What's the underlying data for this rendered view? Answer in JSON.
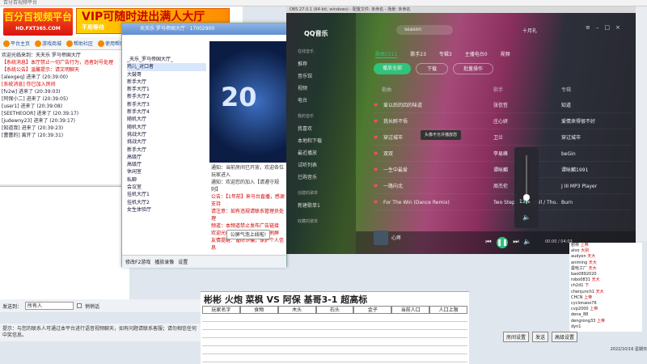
{
  "client": {
    "title": "百分百视频平台",
    "logo_main": "百分百视频平台",
    "logo_sub": "HD.FXT365.COM",
    "vip_text": "VIP可随时进出满人大厅",
    "vip_sub": "不用等待",
    "toolbar": [
      {
        "label": "平台主页"
      },
      {
        "label": "游戏商城"
      },
      {
        "label": "帮助社区"
      },
      {
        "label": "使用帮助"
      }
    ],
    "chatlog": [
      {
        "text": "欢迎光临来到：天天乐 罗马帝国大厅",
        "cls": "c1"
      },
      {
        "text": "【系统消息】本厅禁止一切广告行为，违者封号处理",
        "cls": "c2"
      },
      {
        "text": "【系统公告】温馨提示：请文明聊天",
        "cls": "c2"
      },
      {
        "text": "[alexgeq] 进来了 (20:39:00)",
        "cls": "c1"
      },
      {
        "text": "[系统消息] 你已加入房间",
        "cls": "c2"
      },
      {
        "text": "[fv2w] 进来了 (20:39:03)",
        "cls": "c1"
      },
      {
        "text": "[阿保小二] 进来了 (20:39:05)",
        "cls": "c1"
      },
      {
        "text": "[user1] 进来了 (20:39:08)",
        "cls": "c1"
      },
      {
        "text": "[SEETHEOOR] 进来了 (20:39:17)",
        "cls": "c1"
      },
      {
        "text": "[judewny23] 进来了 (20:39:17)",
        "cls": "c1"
      },
      {
        "text": "[知道我] 进来了 (20:39:23)",
        "cls": "c1"
      },
      {
        "text": "[蕾蕾的] 离开了 (20:39:31)",
        "cls": "c1"
      }
    ],
    "send_label": "发送到：",
    "send_target": "所有人",
    "private_label": "悄悄话",
    "tip_text": "提示：与您的联系人可通过本平台进行语音视频聊天，如有问题请联系客服；请勿相信任何中奖信息。"
  },
  "room": {
    "title": "天天乐 罗马帝国大厅",
    "id_label": "17002900",
    "tree": [
      {
        "label": "_天乐_罗马帝国大厅_",
        "hl": false
      },
      {
        "label": "  鸡儿_对口者",
        "hl": true
      },
      {
        "label": "  大鼓哥",
        "hl": false
      },
      {
        "label": "  新手大厅",
        "hl": false
      },
      {
        "label": "新手大厅1",
        "hl": false
      },
      {
        "label": "新手大厅2",
        "hl": false
      },
      {
        "label": "新手大厅3",
        "hl": false
      },
      {
        "label": "新手大厅4",
        "hl": false
      },
      {
        "label": "随机大厅",
        "hl": false
      },
      {
        "label": "随机大厅",
        "hl": false
      },
      {
        "label": "挑战大厅",
        "hl": false
      },
      {
        "label": "挑战大厅",
        "hl": false
      },
      {
        "label": "新手大厅",
        "hl": false
      },
      {
        "label": "高级厅",
        "hl": false
      },
      {
        "label": "高级厅",
        "hl": false
      },
      {
        "label": "休闲室",
        "hl": false
      },
      {
        "label": "私聊",
        "hl": false
      },
      {
        "label": "会议室",
        "hl": false
      },
      {
        "label": "挂机大厅1",
        "hl": false
      },
      {
        "label": "挂机大厅2",
        "hl": false
      },
      {
        "label": "女生体验厅",
        "hl": false
      }
    ],
    "video_text": "20",
    "announce": [
      {
        "text": "通知：当前房间已开放，欢迎各位玩家进入",
        "cls": ""
      },
      {
        "text": "通知：欢迎您的加入【请遵守规则】",
        "cls": ""
      },
      {
        "text": "公告：【1年前】来马台直播，感谢支持",
        "cls": "r"
      },
      {
        "text": "请注意：如有违规请联系管理员处理",
        "cls": "r"
      },
      {
        "text": "频道：本频道禁止发布广告链接",
        "cls": "r"
      },
      {
        "text": "欢迎光临：请文明聊天，勿刷屏",
        "cls": "r"
      },
      {
        "text": "友情提醒：谨防诈骗，保护个人信息",
        "cls": "r"
      }
    ],
    "bottom": [
      "修改F2游戏",
      "播放录像",
      "设置"
    ],
    "float_btn": "公屏气泡上线啦!"
  },
  "qq": {
    "title": "OBS 27.0.1 (64-bit, windows) - 配置文件: 未命名 - 场景: 未命名",
    "logo": "QQ音乐",
    "search": "season",
    "user": "十月礼",
    "side_head1": "在线音乐",
    "side_items1": [
      "推荐",
      "音乐馆",
      "视频",
      "电台"
    ],
    "side_head2": "我的音乐",
    "side_items2": [
      "我喜欢",
      "本地和下载",
      "最近播放",
      "试听列表",
      "已购音乐"
    ],
    "side_head3": "创建的歌单",
    "side_items3": [
      "新建歌单1"
    ],
    "side_head4": "收藏的歌单",
    "tabs": [
      "歌曲1511",
      "歌手23",
      "专辑3",
      "主播电台0",
      "视频"
    ],
    "play_all": "播放全部",
    "download": "下载",
    "batch": "批量操作",
    "col_song": "歌曲",
    "col_artist": "歌手",
    "col_album": "专辑",
    "songs": [
      {
        "title": "爱以后的四的味道",
        "artist": "张信哲",
        "album": "知道"
      },
      {
        "title": "我长醉不悟",
        "artist": "庄心妍",
        "album": "爱情来得很不好"
      },
      {
        "title": "穿过城市",
        "artist": "卫兰",
        "album": "穿过城市"
      },
      {
        "title": "双双",
        "artist": "李易峰",
        "album": "beGin"
      },
      {
        "title": "一生中最爱",
        "artist": "谭咏麟",
        "album": "谭咏麟1991"
      },
      {
        "title": "一路向北",
        "artist": "周杰伦",
        "album": "J III MP3 Player"
      },
      {
        "title": "For The Win (Dance Remix)",
        "artist": "Two Steps From Hell / Tho...",
        "album": "Burn"
      }
    ],
    "tooltip": "头像不允许播放您",
    "volume_label": "13%",
    "volume_level": 0.13,
    "now_playing": "心疼",
    "time": "00:00 / 04:03"
  },
  "sheet": {
    "title": "彬彬 火炮 菜枫 VS 阿保 基哥3-1 超高标",
    "headers": [
      "玩家名字",
      "食物",
      "木头",
      "石头",
      "金子",
      "当前人口",
      "人口上限"
    ]
  },
  "rbtns": [
    "房间设置",
    "发送",
    "高级设置"
  ],
  "users": [
    {
      "name": "剧林",
      "badge": "上帝"
    },
    {
      "name": "alvo",
      "badge": "大别"
    },
    {
      "name": "audyen",
      "badge": "天大"
    },
    {
      "name": "animing",
      "badge": "天大"
    },
    {
      "name": "曼哈工厂",
      "badge": "天大"
    },
    {
      "name": "bao0892020",
      "badge": ""
    },
    {
      "name": "robo0831",
      "badge": "天大"
    },
    {
      "name": "ch2d1",
      "badge": "下"
    },
    {
      "name": "chenjunch1",
      "badge": "天大"
    },
    {
      "name": "CHCN",
      "badge": "上帝"
    },
    {
      "name": "cyclonaoo76",
      "badge": ""
    },
    {
      "name": "cvp2000",
      "badge": "上帝"
    },
    {
      "name": "dena_88",
      "badge": ""
    },
    {
      "name": "dengrong33",
      "badge": "上帝"
    },
    {
      "name": "dyn1",
      "badge": ""
    }
  ],
  "clock": "2022/10/16 星期日"
}
